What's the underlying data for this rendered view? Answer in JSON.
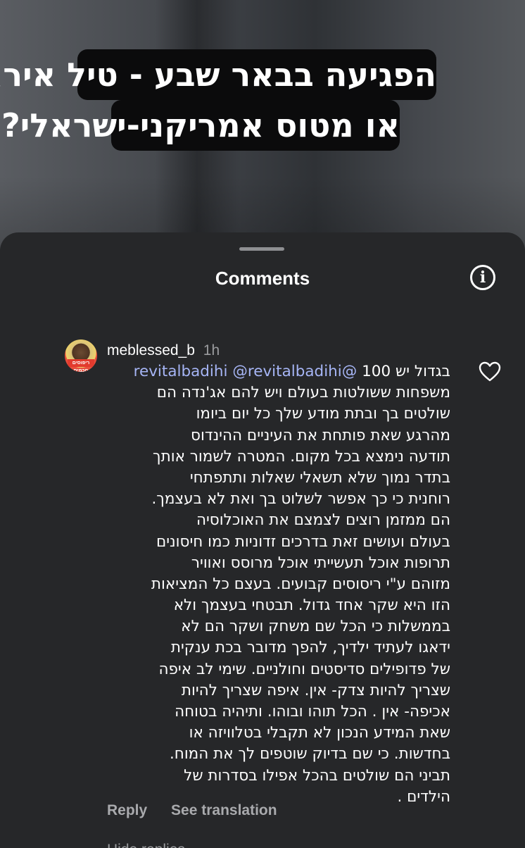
{
  "video": {
    "caption_line1": "הפגיעה בבאר שבע - טיל איראני",
    "caption_line2": "או מטוס אמריקני-ישראלי?"
  },
  "sheet": {
    "title": "Comments",
    "info_icon": "info-icon"
  },
  "comment": {
    "avatar_badge": "ריפוסים חכמים",
    "username": "meblessed_b",
    "time": "1h",
    "mention1": "@revitalbadihi",
    "mention2": "@revitalbadihi",
    "first_line_text": "בגדול יש 100",
    "lines": [
      "משפחות ששולטות בעולם ויש להם אג'נדה הם",
      "שולטים בך ובתת מודע שלך כל יום ביומו",
      "מהרגע שאת פותחת את העיניים ההינדוס",
      "תודעה נימצא בכל מקום. המטרה לשמור אותך",
      "בתדר נמוך שלא תשאלי שאלות ותתפתחי",
      "רוחנית כי כך אפשר לשלוט בך ואת לא בעצמך.",
      "הם ממזמן רוצים לצמצם את האוכלוסיה",
      "בעולם ועושים זאת בדרכים זדוניות כמו חיסונים",
      "תרופות אוכל תעשייתי אוכל מרוסס ואוויר",
      "מזוהם ע\"י ריסוסים קבועים. בעצם כל המציאות",
      "הזו היא שקר אחד גדול. תבטחי בעצמך ולא",
      "בממשלות כי הכל שם משחק ושקר הם לא",
      "ידאגו לעתיד ילדיך, להפך מדובר בכת ענקית",
      "של פדופילים סדיסטים וחולניים. שימי לב איפה",
      "שצריך להיות צדק- אין. איפה שצריך להיות",
      "אכיפה- אין . הכל תוהו ובוהו. ותיהיה בטוחה",
      "שאת המידע הנכון לא תקבלי בטלוויזה או",
      "בחדשות. כי שם בדיוק שוטפים לך את המוח.",
      "תביני הם שולטים בהכל אפילו בסדרות של",
      "הילדים ."
    ],
    "like_icon": "heart-icon",
    "reply_label": "Reply",
    "translate_label": "See translation"
  },
  "next_comment_peek": "Hide replies"
}
